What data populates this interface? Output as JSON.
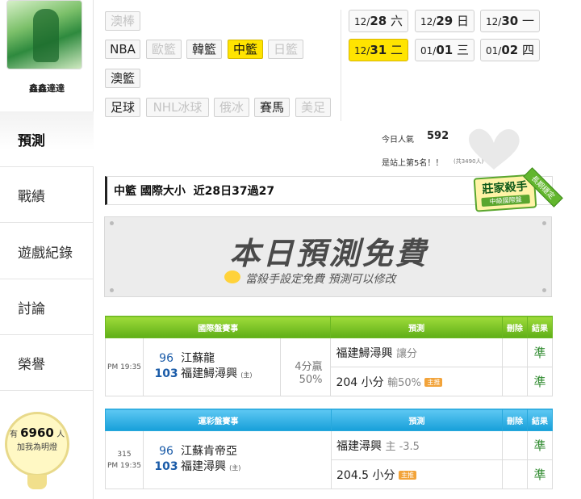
{
  "user": {
    "name": "鑫鑫達達"
  },
  "sidebar": {
    "items": [
      {
        "label": "預測"
      },
      {
        "label": "戰績"
      },
      {
        "label": "遊戲紀錄"
      },
      {
        "label": "討論"
      },
      {
        "label": "榮譽"
      }
    ],
    "bulb": {
      "prefix": "有",
      "count": "6960",
      "suffix": "人",
      "line2": "加我為明燈"
    }
  },
  "filters": {
    "leagues": [
      "澳棒",
      "NBA",
      "歐籃",
      "韓籃",
      "中籃",
      "日籃",
      "澳籃",
      "足球",
      "NHL冰球",
      "俄冰",
      "賽馬",
      "美足"
    ]
  },
  "dates": [
    {
      "md": "12/",
      "d": "28",
      "w": "六"
    },
    {
      "md": "12/",
      "d": "29",
      "w": "日"
    },
    {
      "md": "12/",
      "d": "30",
      "w": "一"
    },
    {
      "md": "12/",
      "d": "31",
      "w": "二"
    },
    {
      "md": "01/",
      "d": "01",
      "w": "三"
    },
    {
      "md": "01/",
      "d": "02",
      "w": "四"
    }
  ],
  "stats": {
    "today_label": "今日人氣",
    "today_value": "592",
    "rank_text": "是站上第5名！！",
    "rank_total": "(共3490人)"
  },
  "title": {
    "league": "中籃",
    "market": "國際大小",
    "record": "近28日37過27"
  },
  "badge": {
    "name": "莊家殺手",
    "sub": "中級國際盤",
    "ribbon": "長期穩定"
  },
  "banner": {
    "title": "本日預測免費",
    "subtitle": "當殺手設定免費  預測可以修改"
  },
  "table1": {
    "headers": [
      "國際盤賽事",
      "預測",
      "刪除",
      "結果"
    ],
    "time": "PM 19:35",
    "away_score": "96",
    "away_name": "江蘇龍",
    "home_score": "103",
    "home_name": "福建鱘潯興",
    "home_mark": "(主)",
    "side_top": "4分贏",
    "side_bottom": "50%",
    "pred1_main": "福建鱘潯興",
    "pred1_sub": "讓分",
    "pred2_main": "204 小分",
    "pred2_sub": "輸50%",
    "pred2_tag": "主推",
    "result1": "準",
    "result2": "準"
  },
  "table2": {
    "headers": [
      "運彩盤賽事",
      "預測",
      "刪除",
      "結果"
    ],
    "game_no": "315",
    "time": "PM 19:35",
    "away_score": "96",
    "away_name": "江蘇肯帝亞",
    "home_score": "103",
    "home_name": "福建潯興",
    "home_mark": "(主)",
    "pred1_main": "福建潯興",
    "pred1_sub": "主 -3.5",
    "pred2_main": "204.5 小分",
    "pred2_tag": "主推",
    "result1": "準",
    "result2": "準"
  },
  "colors": {
    "selected": "#ffe400",
    "green_header": "#6cb822",
    "blue_header": "#28a8dc",
    "result": "#2e8a2e"
  }
}
